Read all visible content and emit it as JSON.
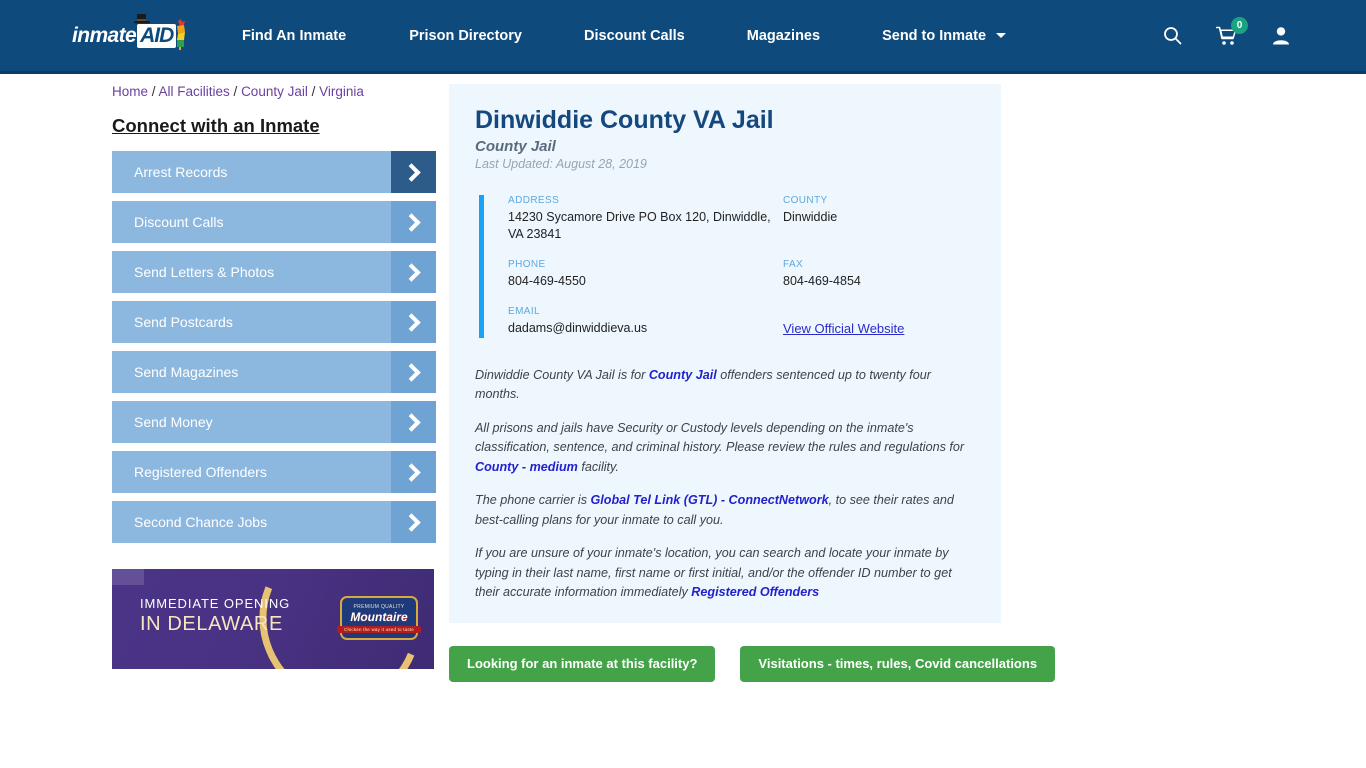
{
  "header": {
    "logo": {
      "text": "inmate",
      "badge": "AID",
      "alt": "inmateaid-logo"
    },
    "nav": [
      {
        "label": "Find An Inmate"
      },
      {
        "label": "Prison Directory"
      },
      {
        "label": "Discount Calls"
      },
      {
        "label": "Magazines"
      },
      {
        "label": "Send to Inmate",
        "has_caret": true
      }
    ],
    "icons": {
      "search": "search-icon",
      "cart": "cart-icon",
      "cart_count": "0",
      "account": "user-icon"
    },
    "colors": {
      "bg": "#0e4a7b",
      "badge": "#1aa380"
    }
  },
  "breadcrumb": [
    {
      "label": "Home"
    },
    {
      "label": "All Facilities"
    },
    {
      "label": "County Jail"
    },
    {
      "label": "Virginia"
    }
  ],
  "breadcrumb_separator": "/",
  "sidebar": {
    "title": "Connect with an Inmate",
    "items": [
      {
        "label": "Arrest Records",
        "active": true
      },
      {
        "label": "Discount Calls",
        "active": false
      },
      {
        "label": "Send Letters & Photos",
        "active": false
      },
      {
        "label": "Send Postcards",
        "active": false
      },
      {
        "label": "Send Magazines",
        "active": false
      },
      {
        "label": "Send Money",
        "active": false
      },
      {
        "label": "Registered Offenders",
        "active": false
      },
      {
        "label": "Second Chance Jobs",
        "active": false
      }
    ]
  },
  "ad": {
    "line1": "IMMEDIATE OPENING",
    "line2": "IN DELAWARE",
    "logo_top": "PREMIUM QUALITY",
    "logo_name": "Mountaire",
    "logo_sub": "Chicken the way it used to taste"
  },
  "facility": {
    "name": "Dinwiddie County VA Jail",
    "type": "County Jail",
    "updated": "Last Updated: August 28, 2019",
    "fields": [
      {
        "label": "ADDRESS",
        "value": "14230 Sycamore Drive PO Box 120, Dinwiddle, VA 23841"
      },
      {
        "label": "COUNTY",
        "value": "Dinwiddie"
      },
      {
        "label": "PHONE",
        "value": "804-469-4550"
      },
      {
        "label": "FAX",
        "value": "804-469-4854"
      },
      {
        "label": "EMAIL",
        "value": "dadams@dinwiddieva.us"
      }
    ],
    "website_link": "View Official Website"
  },
  "description": {
    "p1_a": "Dinwiddie County VA Jail is for ",
    "p1_link": "County Jail",
    "p1_b": " offenders sentenced up to twenty four months.",
    "p2_a": "All prisons and jails have Security or Custody levels depending on the inmate's classification, sentence, and criminal history. Please review the rules and regulations for ",
    "p2_link": "County - medium",
    "p2_b": " facility.",
    "p3_a": "The phone carrier is ",
    "p3_link": "Global Tel Link (GTL) - ConnectNetwork",
    "p3_b": ", to see their rates and best-calling plans for your inmate to call you.",
    "p4_a": "If you are unsure of your inmate's location, you can search and locate your inmate by typing in their last name, first name or first initial, and/or the offender ID number to get their accurate information immediately ",
    "p4_link": "Registered Offenders"
  },
  "cta": {
    "primary": "Looking for an inmate at this facility?",
    "secondary": "Visitations - times, rules, Covid cancellations"
  }
}
